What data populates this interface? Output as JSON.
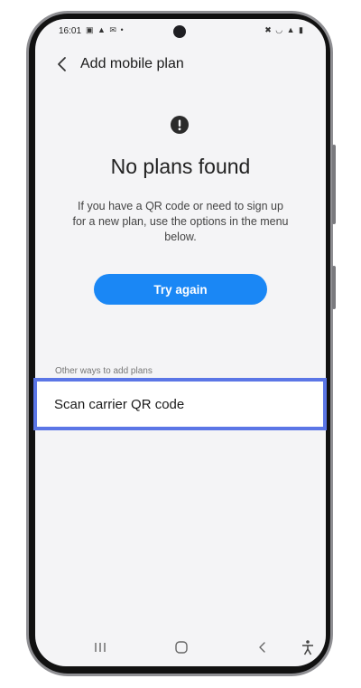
{
  "status_bar": {
    "time": "16:01",
    "left_icons": "▣ ▲ ✉ •",
    "right_icons": "✖ ◡ ▲ ▮"
  },
  "header": {
    "title": "Add mobile plan",
    "back_icon": "chevron-left-icon"
  },
  "main": {
    "alert_icon": "exclamation-circle-icon",
    "headline": "No plans found",
    "description": "If you have a QR code or need to sign up for a new plan, use the options in the menu below.",
    "try_again_label": "Try again",
    "accent_color": "#1a87f5"
  },
  "other_ways": {
    "section_label": "Other ways to add plans",
    "items": [
      {
        "label": "Scan carrier QR code"
      }
    ]
  },
  "highlight_color": "#5b76e6",
  "nav_bar": {
    "icons": [
      "recent-apps-icon",
      "home-icon",
      "back-icon",
      "accessibility-icon"
    ]
  }
}
